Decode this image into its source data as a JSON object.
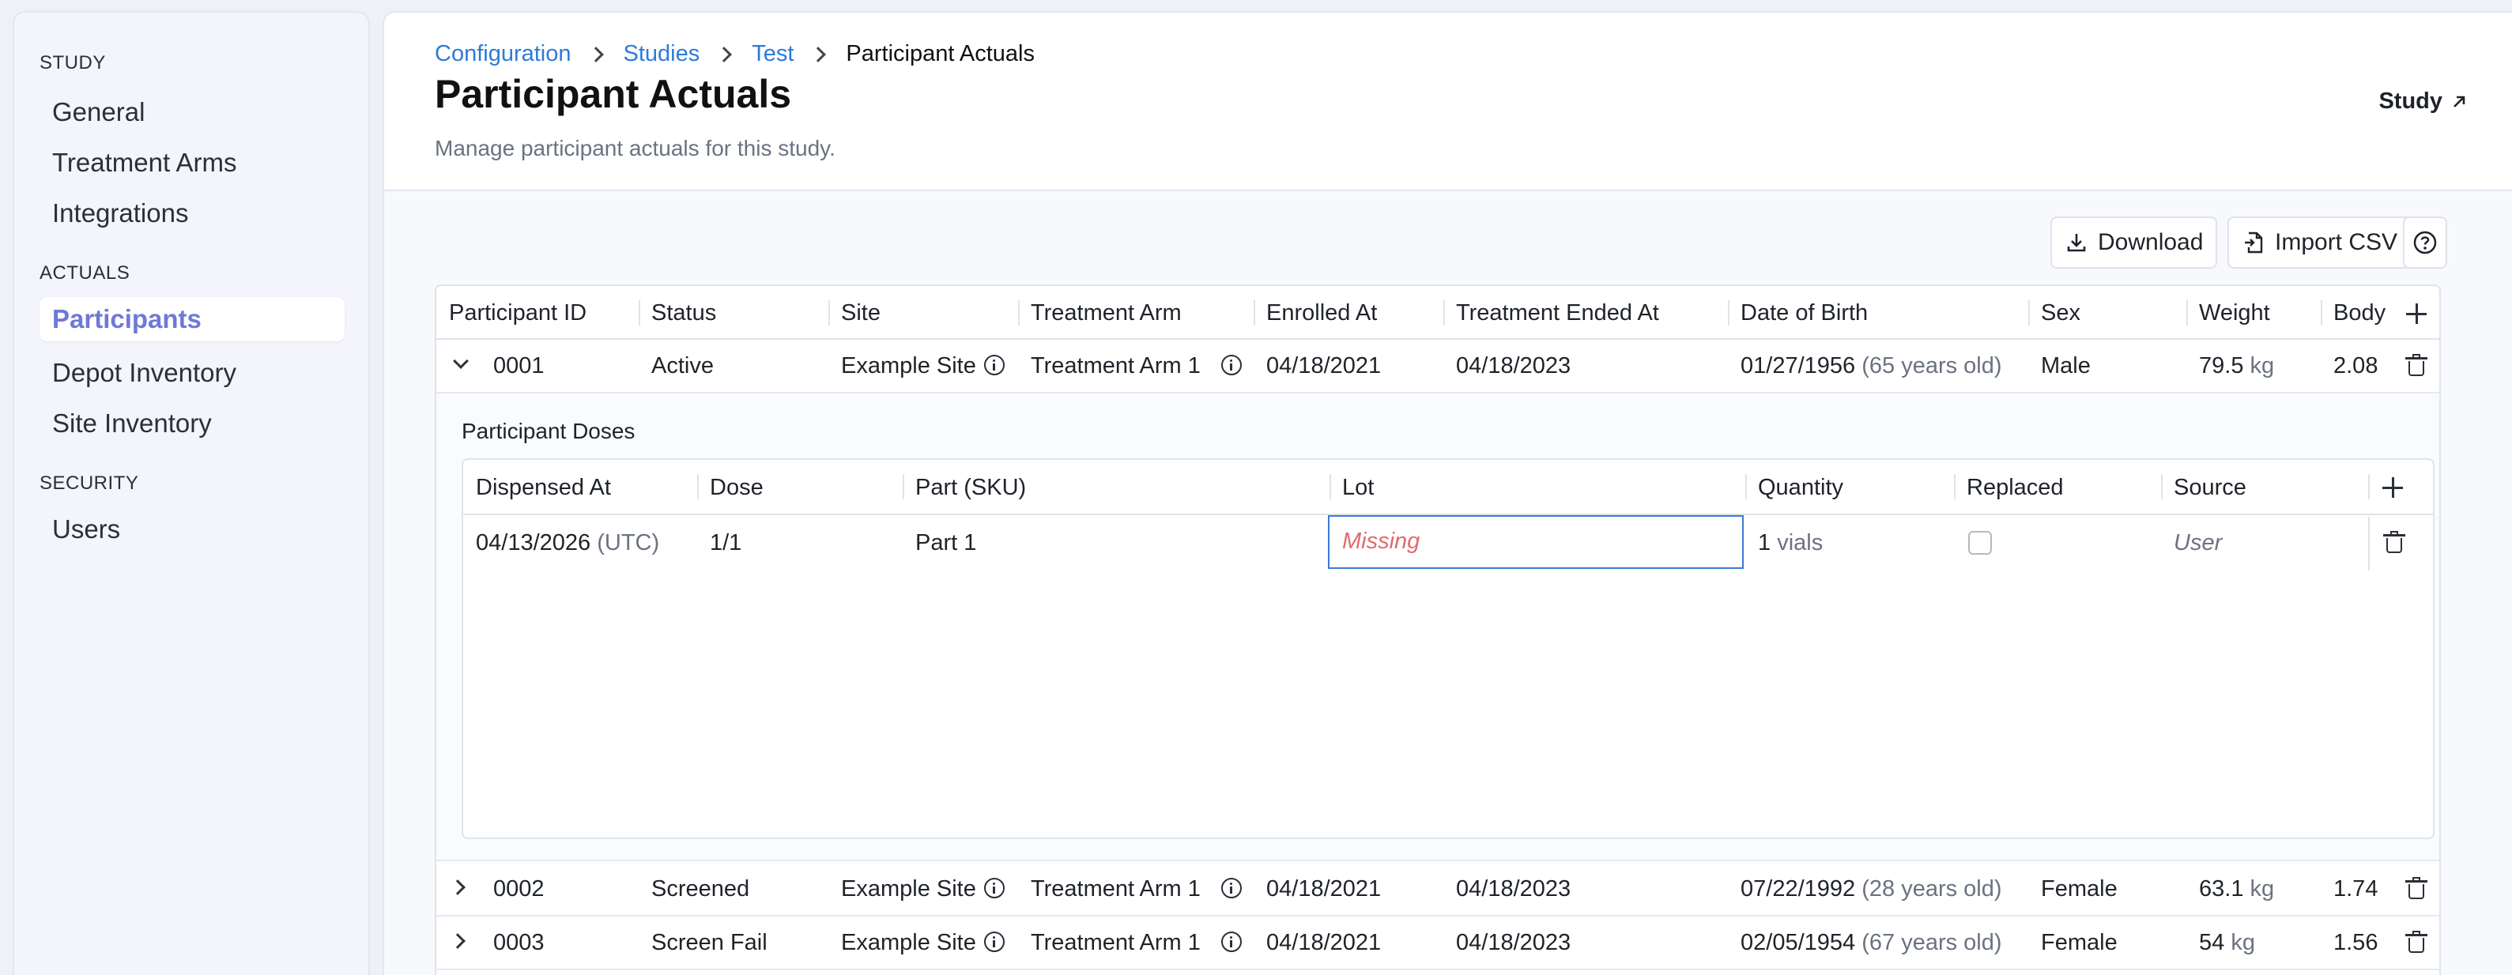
{
  "sidebar": {
    "sections": [
      {
        "title": "STUDY",
        "items": [
          "General",
          "Treatment Arms",
          "Integrations"
        ]
      },
      {
        "title": "ACTUALS",
        "items": [
          "Participants",
          "Depot Inventory",
          "Site Inventory"
        ]
      },
      {
        "title": "SECURITY",
        "items": [
          "Users"
        ]
      }
    ],
    "active_item": "Participants"
  },
  "breadcrumb": [
    "Configuration",
    "Studies",
    "Test",
    "Participant Actuals"
  ],
  "page": {
    "title": "Participant Actuals",
    "subtitle": "Manage participant actuals for this study.",
    "study_link": "Study"
  },
  "toolbar": {
    "download_label": "Download",
    "import_label": "Import CSV"
  },
  "table": {
    "columns": [
      "Participant ID",
      "Status",
      "Site",
      "Treatment Arm",
      "Enrolled At",
      "Treatment Ended At",
      "Date of Birth",
      "Sex",
      "Weight",
      "Body"
    ],
    "rows": [
      {
        "id": "0001",
        "status": "Active",
        "site": "Example Site",
        "arm": "Treatment Arm 1",
        "enrolled": "04/18/2021",
        "ended": "04/18/2023",
        "dob": "01/27/1956",
        "age": "(65 years old)",
        "sex": "Male",
        "weight": "79.5",
        "weight_unit": "kg",
        "body": "2.08"
      },
      {
        "id": "0002",
        "status": "Screened",
        "site": "Example Site",
        "arm": "Treatment Arm 1",
        "enrolled": "04/18/2021",
        "ended": "04/18/2023",
        "dob": "07/22/1992",
        "age": "(28 years old)",
        "sex": "Female",
        "weight": "63.1",
        "weight_unit": "kg",
        "body": "1.74"
      },
      {
        "id": "0003",
        "status": "Screen Fail",
        "site": "Example Site",
        "arm": "Treatment Arm 1",
        "enrolled": "04/18/2021",
        "ended": "04/18/2023",
        "dob": "02/05/1954",
        "age": "(67 years old)",
        "sex": "Female",
        "weight": "54",
        "weight_unit": "kg",
        "body": "1.56"
      }
    ]
  },
  "doses": {
    "title": "Participant Doses",
    "columns": [
      "Dispensed At",
      "Dose",
      "Part (SKU)",
      "Lot",
      "Quantity",
      "Replaced",
      "Source"
    ],
    "row": {
      "dispensed": "04/13/2026",
      "tz": "(UTC)",
      "dose": "1/1",
      "part": "Part 1",
      "lot": "Missing",
      "qty": "1",
      "qty_unit": "vials",
      "replaced": false,
      "source": "User"
    }
  },
  "colors": {
    "accent": "#6e78d8",
    "link": "#2e7ad9",
    "missing": "#e36b6b",
    "focus": "#3a7bd5"
  }
}
